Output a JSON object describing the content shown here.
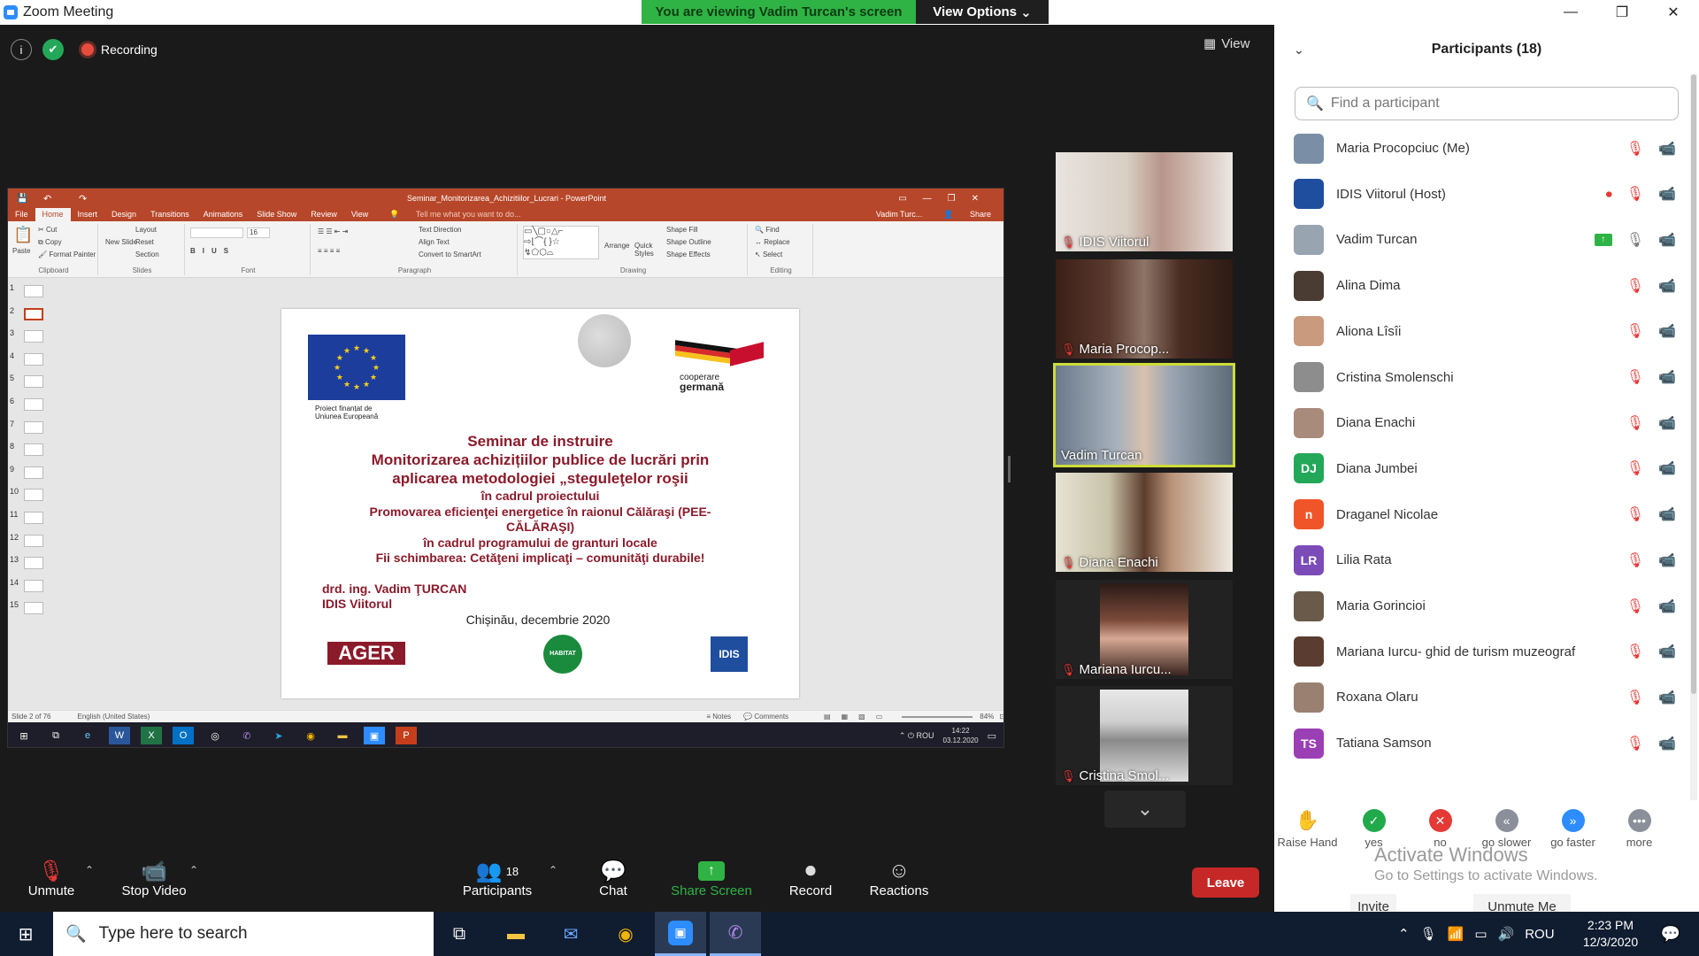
{
  "window": {
    "title": "Zoom Meeting",
    "viewing_banner": "You are viewing Vadim Turcan's screen",
    "view_options": "View Options"
  },
  "meeting": {
    "recording": "Recording",
    "view": "View"
  },
  "powerpoint": {
    "title": "Seminar_Monitorizarea_Achizitiilor_Lucrari - PowerPoint",
    "user": "Vadim Turc...",
    "share": "Share",
    "tabs": [
      "File",
      "Home",
      "Insert",
      "Design",
      "Transitions",
      "Animations",
      "Slide Show",
      "Review",
      "View"
    ],
    "tell_me": "Tell me what you want to do...",
    "ribbon": {
      "paste": "Paste",
      "cut": "Cut",
      "copy": "Copy",
      "format_painter": "Format Painter",
      "clipboard": "Clipboard",
      "new_slide": "New Slide",
      "layout": "Layout",
      "reset": "Reset",
      "section": "Section",
      "slides": "Slides",
      "font": "Font",
      "paragraph": "Paragraph",
      "text_direction": "Text Direction",
      "align_text": "Align Text",
      "convert": "Convert to SmartArt",
      "arrange": "Arrange",
      "quick_styles": "Quick Styles",
      "shape_fill": "Shape Fill",
      "shape_outline": "Shape Outline",
      "shape_effects": "Shape Effects",
      "drawing": "Drawing",
      "find": "Find",
      "replace": "Replace",
      "select": "Select",
      "editing": "Editing",
      "font_size": "16"
    },
    "thumb_numbers": [
      "1",
      "2",
      "3",
      "4",
      "5",
      "6",
      "7",
      "8",
      "9",
      "10",
      "11",
      "12",
      "13",
      "14",
      "15"
    ],
    "slide": {
      "eu_caption_1": "Proiect finanțat de",
      "eu_caption_2": "Uniunea Europeană",
      "coop_1": "cooperare",
      "coop_2": "germană",
      "line1": "Seminar de instruire",
      "line2": "Monitorizarea achizițiilor publice de lucrări prin",
      "line3": "aplicarea metodologiei „steguleţelor roşii",
      "line4": "în cadrul proiectului",
      "line5": "Promovarea eficienţei energetice în raionul Călăraşi (PEE-",
      "line6": "CĂLĂRAŞI)",
      "line7": "în cadrul programului de granturi locale",
      "line8": "Fii schimbarea: Cetăţeni implicaţi – comunităţi durabile!",
      "author1": "drd. ing. Vadim ŢURCAN",
      "author2": "IDIS Viitorul",
      "place": "Chișinău, decembrie 2020",
      "logo_ager": "AGER",
      "logo_habitat": "HABITAT",
      "logo_idis": "IDIS"
    },
    "status": {
      "slide": "Slide 2 of 76",
      "lang": "English (United States)",
      "notes": "Notes",
      "comments": "Comments",
      "zoom": "84%"
    },
    "inner_taskbar": {
      "lang": "ROU",
      "time": "14:22",
      "date": "03.12.2020"
    }
  },
  "videos": [
    {
      "name": "IDIS Viitorul",
      "muted": true
    },
    {
      "name": "Maria Procop...",
      "muted": true
    },
    {
      "name": "Vadim Turcan",
      "muted": false
    },
    {
      "name": "Diana Enachi",
      "muted": true
    },
    {
      "name": "Mariana Iurcu...",
      "muted": true
    },
    {
      "name": "Cristina Smol...",
      "muted": true
    }
  ],
  "toolbar": {
    "unmute": "Unmute",
    "stop_video": "Stop Video",
    "participants": "Participants",
    "participants_count": "18",
    "chat": "Chat",
    "share_screen": "Share Screen",
    "record": "Record",
    "reactions": "Reactions",
    "leave": "Leave"
  },
  "panel": {
    "title": "Participants (18)",
    "search_placeholder": "Find a participant",
    "participants": [
      {
        "name": "Maria Procopciuc (Me)",
        "avatar": "",
        "color": "#7a8fa6",
        "cam": "on"
      },
      {
        "name": "IDIS Viitorul (Host)",
        "avatar": "",
        "color": "#1f4e9e",
        "cam": "on",
        "host": true
      },
      {
        "name": "Vadim Turcan",
        "avatar": "",
        "color": "#98a4b0",
        "cam": "on",
        "sharing": true
      },
      {
        "name": "Alina Dima",
        "avatar": "",
        "color": "#4a3b33",
        "cam": "off"
      },
      {
        "name": "Aliona Lîsîi",
        "avatar": "",
        "color": "#c99a7d",
        "cam": "off"
      },
      {
        "name": "Cristina Smolenschi",
        "avatar": "",
        "color": "#8d8d8d",
        "cam": "off"
      },
      {
        "name": "Diana Enachi",
        "avatar": "",
        "color": "#a98b7c",
        "cam": "on"
      },
      {
        "name": "Diana Jumbei",
        "avatar": "DJ",
        "color": "#23a85a",
        "cam": "off"
      },
      {
        "name": "Draganel Nicolae",
        "avatar": "n",
        "color": "#f0552a",
        "cam": "off"
      },
      {
        "name": "Lilia Rata",
        "avatar": "LR",
        "color": "#7b4bb8",
        "cam": "off"
      },
      {
        "name": "Maria Gorincioi",
        "avatar": "",
        "color": "#6a5a4a",
        "cam": "off"
      },
      {
        "name": "Mariana Iurcu- ghid de turism muzeograf",
        "avatar": "",
        "color": "#5a3d30",
        "cam": "off"
      },
      {
        "name": "Roxana Olaru",
        "avatar": "",
        "color": "#9a8070",
        "cam": "off"
      },
      {
        "name": "Tatiana Samson",
        "avatar": "TS",
        "color": "#9b3fb5",
        "cam": "off"
      }
    ],
    "reactions": [
      {
        "label": "Raise Hand",
        "icon": "✋",
        "color": "#ffffff"
      },
      {
        "label": "yes",
        "icon": "✓",
        "color": "#21a94b"
      },
      {
        "label": "no",
        "icon": "✕",
        "color": "#e53935"
      },
      {
        "label": "go slower",
        "icon": "«",
        "color": "#8a8f9a"
      },
      {
        "label": "go faster",
        "icon": "»",
        "color": "#2d8cff"
      },
      {
        "label": "more",
        "icon": "•••",
        "color": "#8a8f9a"
      }
    ],
    "activate_1": "Activate Windows",
    "activate_2": "Go to Settings to activate Windows.",
    "invite": "Invite",
    "unmute_me": "Unmute Me"
  },
  "taskbar": {
    "search_placeholder": "Type here to search",
    "lang": "ROU",
    "time": "2:23 PM",
    "date": "12/3/2020"
  }
}
